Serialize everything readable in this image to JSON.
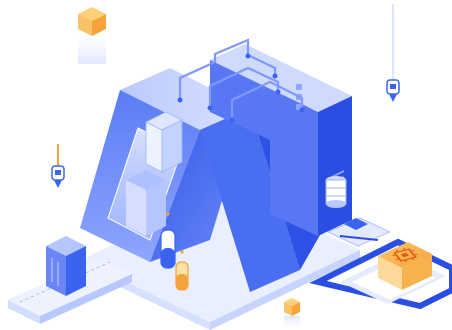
{
  "heading": {
    "text": ""
  },
  "colors": {
    "primary_blue": "#3a63ef",
    "light_blue": "#9db4ff",
    "pale_blue": "#dfe7ff",
    "deep_blue": "#2347d8",
    "orange": "#f5a33a",
    "orange_light": "#ffd27a",
    "dark_text": "#1f2f55"
  },
  "icons": {
    "chip": "cpu-chip-icon",
    "pin": "pin-marker-icon",
    "cube": "cube-icon"
  }
}
